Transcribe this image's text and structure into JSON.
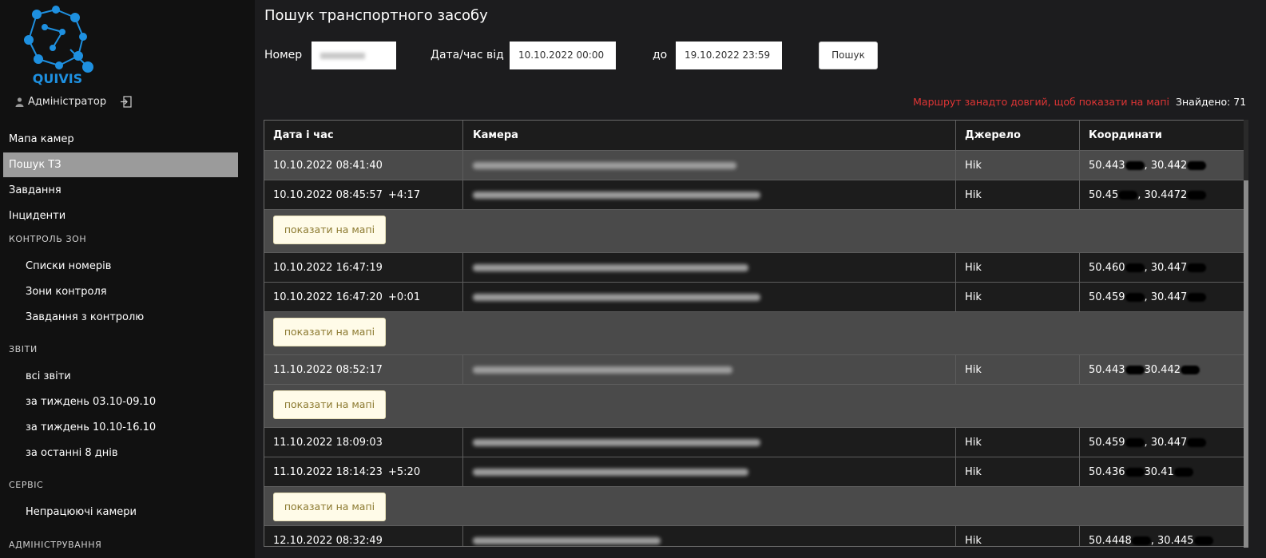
{
  "brand": {
    "name": "QUIVIS",
    "accent": "#1e90e0"
  },
  "user": {
    "name": "Адміністратор"
  },
  "nav": {
    "items": [
      {
        "label": "Мапа камер",
        "active": false
      },
      {
        "label": "Пошук ТЗ",
        "active": true
      },
      {
        "label": "Завдання",
        "active": false
      },
      {
        "label": "Інциденти",
        "active": false
      }
    ],
    "sections": [
      {
        "title": "КОНТРОЛЬ ЗОН",
        "items": [
          "Списки номерів",
          "Зони контроля",
          "Завдання з контролю"
        ]
      },
      {
        "title": "ЗВІТИ",
        "items": [
          "всі звіти",
          "за тиждень 03.10-09.10",
          "за тиждень 10.10-16.10",
          "за останні 8 днів"
        ]
      },
      {
        "title": "СЕРВІС",
        "items": [
          "Непрацюючі камери"
        ]
      },
      {
        "title": "АДМІНІСТРУВАННЯ",
        "items": []
      }
    ]
  },
  "page": {
    "title": "Пошук транспортного засобу"
  },
  "search": {
    "number_label": "Номер",
    "datetime_from_label": "Дата/час від",
    "datetime_from_value": "10.10.2022 00:00",
    "to_label": "до",
    "datetime_to_value": "19.10.2022 23:59",
    "button_label": "Пошук"
  },
  "status": {
    "route_warning": "Маршрут занадто довгий, щоб показати на мапі",
    "found": "Знайдено: 71",
    "warning_color": "#e03535"
  },
  "table": {
    "headers": [
      "Дата і час",
      "Камера",
      "Джерело",
      "Координати"
    ],
    "map_button_label": "показати на мапі",
    "rows": [
      {
        "datetime": "10.10.2022 08:41:40",
        "delta": "",
        "source": "Hik",
        "coords_a": "50.443",
        "coords_b": ", 30.442"
      },
      {
        "datetime": "10.10.2022 08:45:57",
        "delta": "+4:17",
        "source": "Hik",
        "coords_a": "50.45",
        "coords_b": ", 30.4472"
      },
      {
        "datetime": "10.10.2022 16:47:19",
        "delta": "",
        "source": "Hik",
        "coords_a": "50.460",
        "coords_b": ", 30.447"
      },
      {
        "datetime": "10.10.2022 16:47:20",
        "delta": "+0:01",
        "source": "Hik",
        "coords_a": "50.459",
        "coords_b": ", 30.447"
      },
      {
        "datetime": "11.10.2022 08:52:17",
        "delta": "",
        "source": "Hik",
        "coords_a": "50.443",
        "coords_b": " 30.442"
      },
      {
        "datetime": "11.10.2022 18:09:03",
        "delta": "",
        "source": "Hik",
        "coords_a": "50.459",
        "coords_b": ", 30.447"
      },
      {
        "datetime": "11.10.2022 18:14:23",
        "delta": "+5:20",
        "source": "Hik",
        "coords_a": "50.436",
        "coords_b": " 30.41"
      },
      {
        "datetime": "12.10.2022 08:32:49",
        "delta": "",
        "source": "Hik",
        "coords_a": "50.4448",
        "coords_b": ", 30.445"
      }
    ]
  }
}
